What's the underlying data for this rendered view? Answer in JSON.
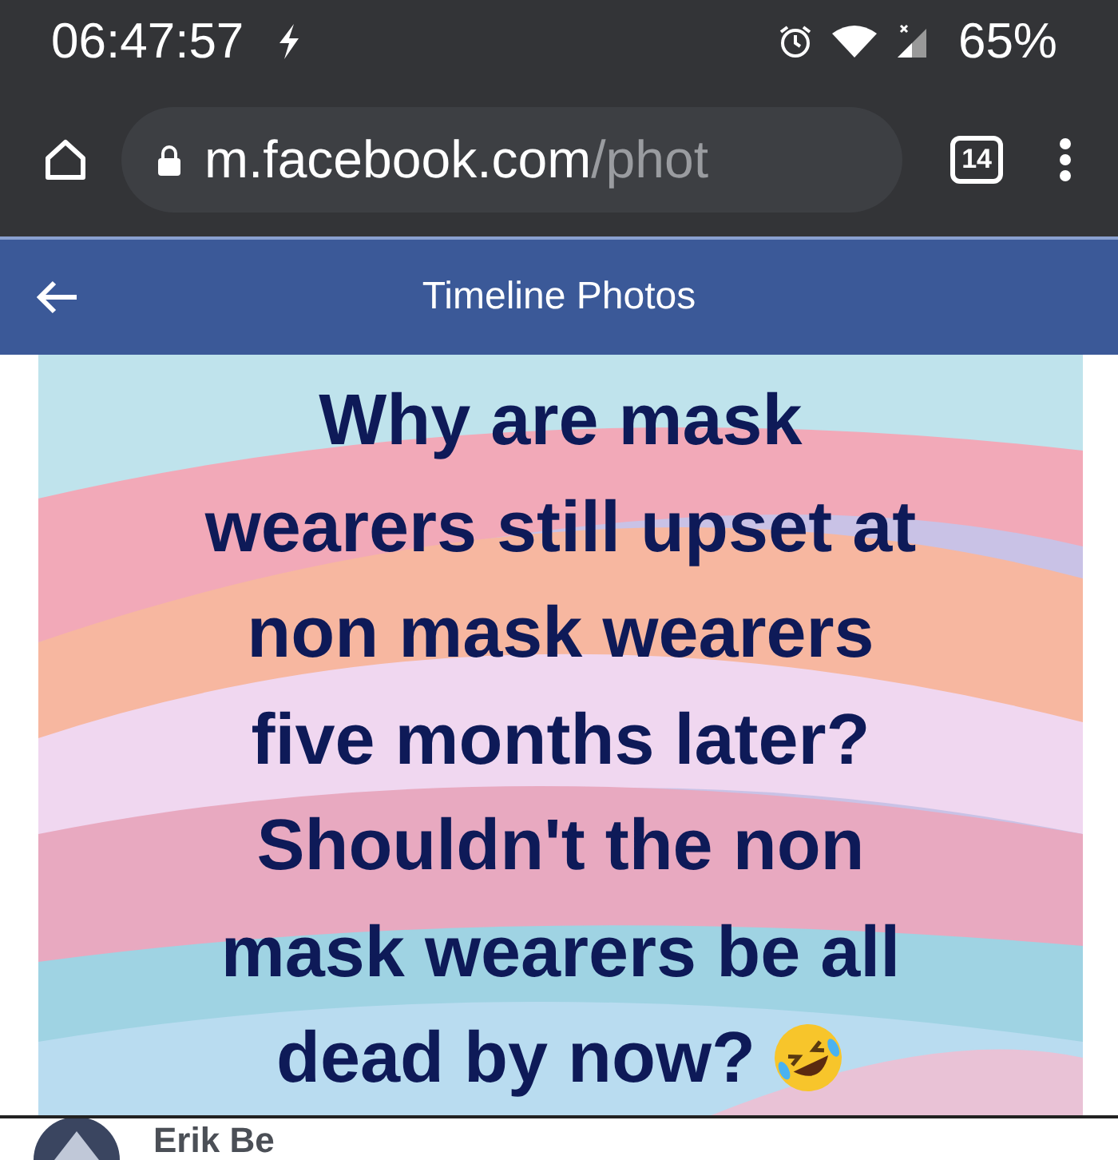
{
  "status_bar": {
    "time": "06:47:57",
    "battery": "65%"
  },
  "browser": {
    "url_host": "m.facebook.com",
    "url_path": "/phot",
    "tab_count": "14"
  },
  "header": {
    "title": "Timeline Photos"
  },
  "post_image": {
    "lines": [
      "Why are mask",
      "wearers still upset at",
      "non mask wearers",
      "five months later?",
      "Shouldn't the non",
      "mask wearers be all",
      "dead by now?"
    ]
  },
  "author": {
    "name": "Erik Be"
  }
}
